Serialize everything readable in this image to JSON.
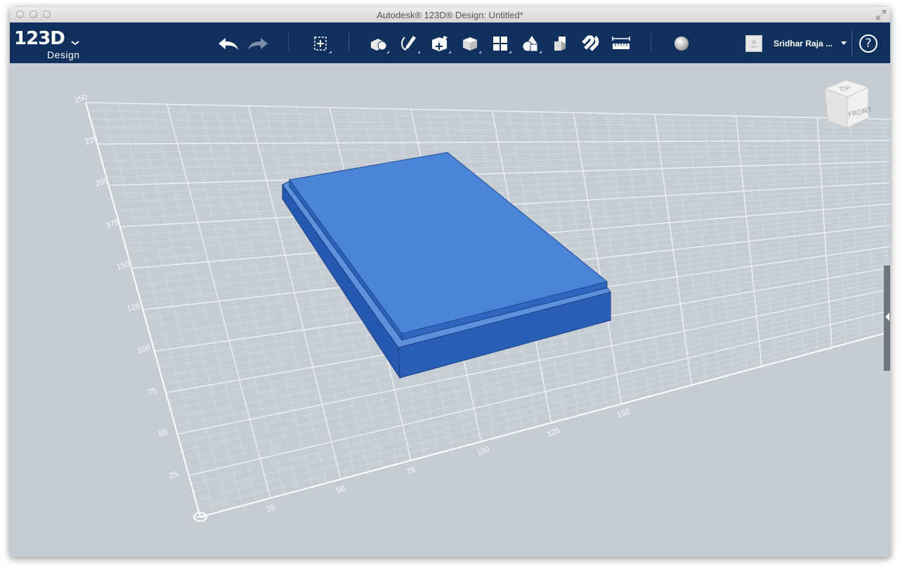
{
  "window": {
    "title": "Autodesk® 123D® Design: Untitled*"
  },
  "logo": {
    "number": "123D",
    "word": "Design"
  },
  "toolbar": {
    "tools": [
      {
        "name": "undo",
        "icon": "undo-arrow-icon"
      },
      {
        "name": "redo",
        "icon": "redo-arrow-icon"
      },
      {
        "name": "transform",
        "icon": "transform-icon"
      },
      {
        "name": "primitives",
        "icon": "primitives-icon"
      },
      {
        "name": "sketch",
        "icon": "sketch-icon"
      },
      {
        "name": "construct",
        "icon": "construct-icon"
      },
      {
        "name": "modify",
        "icon": "modify-icon"
      },
      {
        "name": "pattern",
        "icon": "pattern-icon"
      },
      {
        "name": "grouping",
        "icon": "grouping-icon"
      },
      {
        "name": "combine",
        "icon": "combine-icon"
      },
      {
        "name": "snap",
        "icon": "snap-magnet-icon"
      },
      {
        "name": "measure",
        "icon": "measure-ruler-icon"
      },
      {
        "name": "material",
        "icon": "material-sphere-icon"
      }
    ],
    "user_name": "Sridhar Raja ...",
    "help_label": "?"
  },
  "viewcube": {
    "top_label": "TOP",
    "front_label": "FRONT"
  },
  "grid": {
    "left_axis_labels": [
      "25",
      "50",
      "75",
      "100",
      "125",
      "150",
      "175",
      "200",
      "225",
      "250"
    ],
    "bottom_axis_labels": [
      "25",
      "50",
      "75",
      "100",
      "125",
      "150"
    ]
  },
  "colors": {
    "toolbar_bg": "#10305e",
    "viewport_bg": "#c6ccd4",
    "model_top": "#4a85d8",
    "model_side": "#2a5fb8"
  }
}
